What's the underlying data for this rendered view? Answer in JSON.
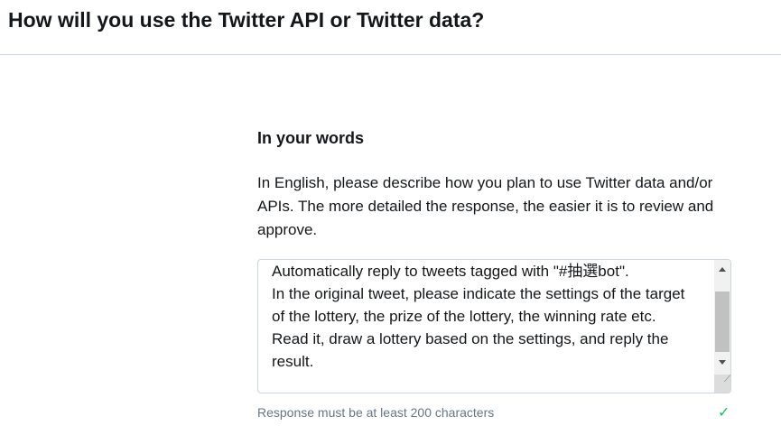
{
  "header": {
    "title": "How will you use the Twitter API or Twitter data?"
  },
  "section": {
    "heading": "In your words",
    "description": "In English, please describe how you plan to use Twitter data and/or APIs. The more detailed the response, the easier it is to review and approve.",
    "response_value": "Automatically reply to tweets tagged with \"#抽選bot\".\nIn the original tweet, please indicate the settings of the target of the lottery, the prize of the lottery, the winning rate etc. Read it, draw a lottery based on the settings, and reply the result.",
    "hint": "Response must be at least 200 characters",
    "valid_icon": "checkmark-icon",
    "colors": {
      "valid": "#17bf63",
      "hint": "#657786"
    }
  }
}
